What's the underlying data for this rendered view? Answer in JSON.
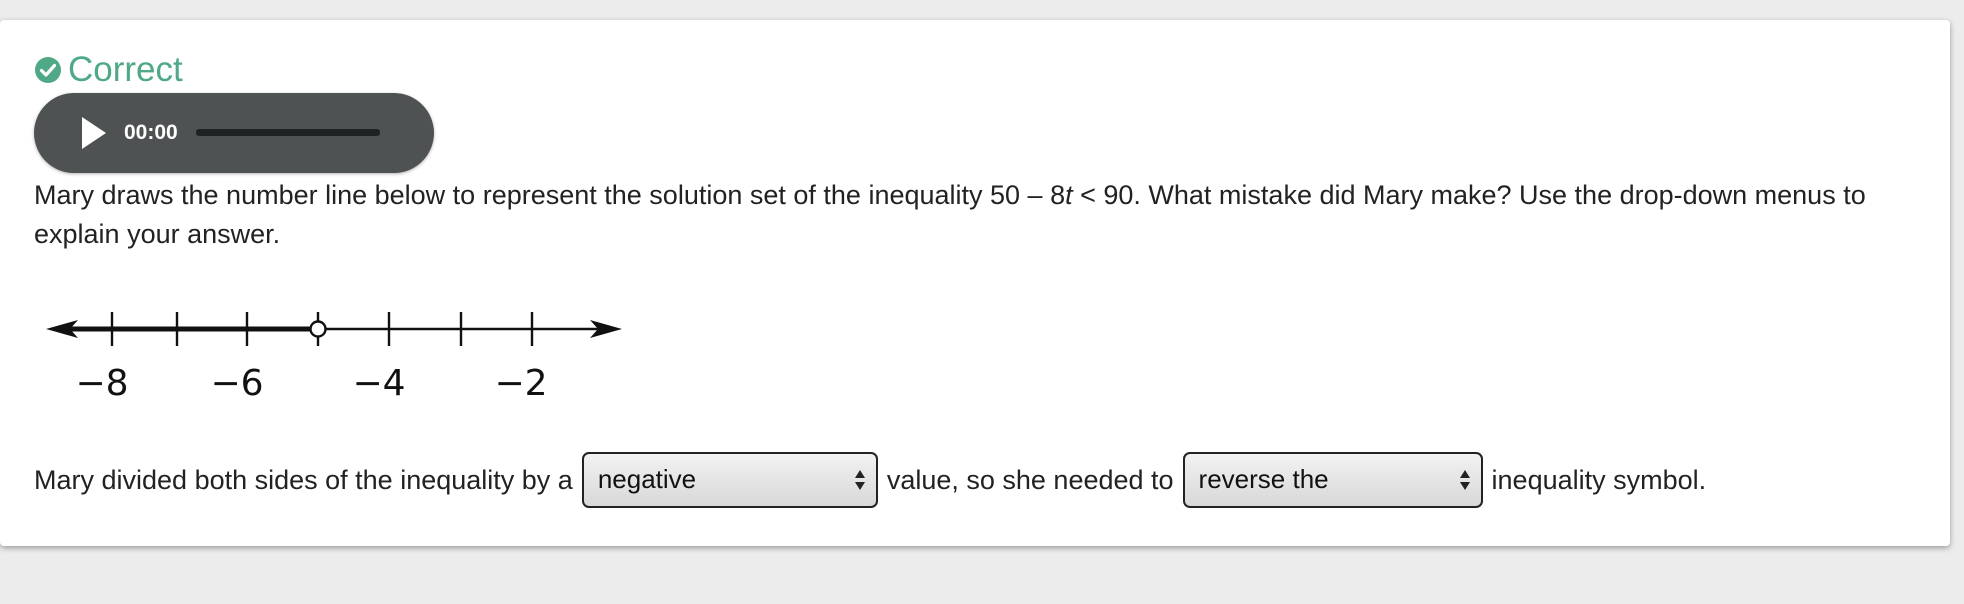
{
  "status": {
    "label": "Correct",
    "color": "#4fa986",
    "icon": "check-circle-icon"
  },
  "audio_player": {
    "time": "00:00",
    "play_icon": "play-icon"
  },
  "question": {
    "text_before": "Mary draws the number line below to represent the solution set of the inequality 50 – 8",
    "variable": "t",
    "text_after": " < 90. What mistake did Mary make? Use the drop-down menus to explain your answer."
  },
  "number_line": {
    "tick_labels": [
      "−8",
      "−6",
      "−4",
      "−2"
    ],
    "open_circle_at": -5,
    "shaded_direction": "left"
  },
  "answer": {
    "text_1": "Mary divided both sides of the inequality by a",
    "select_1_value": "negative",
    "text_2": "value, so she needed to",
    "select_2_value": "reverse the",
    "text_3": "inequality symbol."
  }
}
